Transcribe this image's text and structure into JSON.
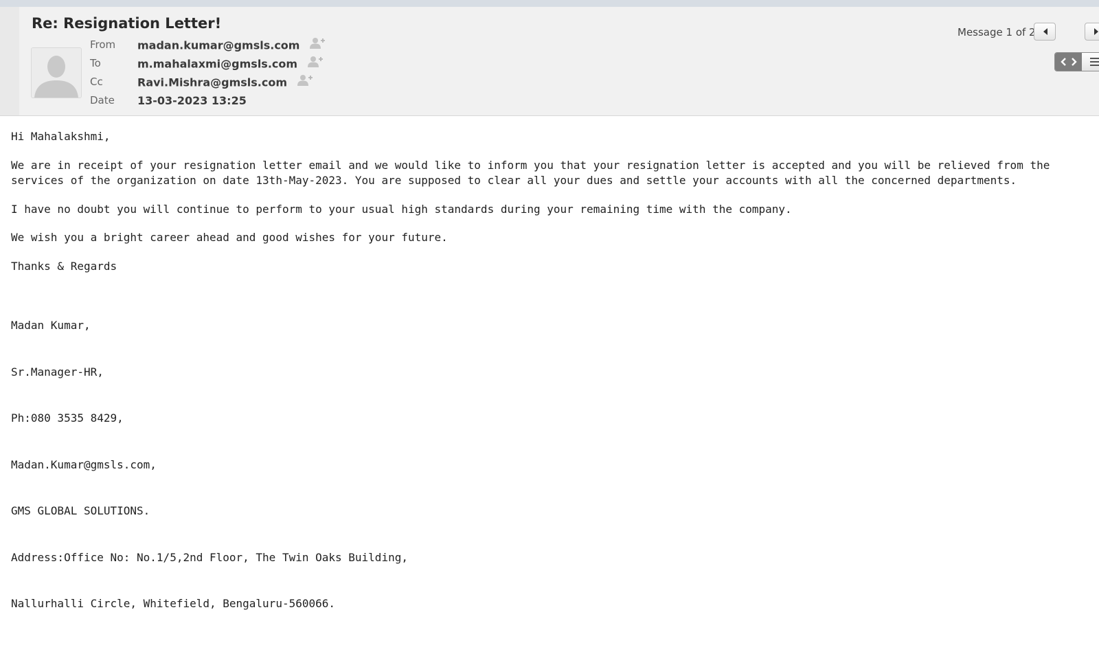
{
  "message": {
    "subject": "Re: Resignation Letter!",
    "counter": "Message 1 of 2",
    "fields": {
      "from_label": "From",
      "from_value": "madan.kumar@gmsls.com",
      "to_label": "To",
      "to_value": "m.mahalaxmi@gmsls.com",
      "cc_label": "Cc",
      "cc_value": "Ravi.Mishra@gmsls.com",
      "date_label": "Date",
      "date_value": "13-03-2023 13:25"
    }
  },
  "body": {
    "greeting": "Hi Mahalakshmi,",
    "para1": "We are in receipt of your resignation letter email and we would like to inform you that your resignation letter is accepted and you will be relieved from the services of the organization on date 13th-May-2023. You are supposed to clear all your dues and settle your accounts with all the concerned departments.",
    "para2": "I have no doubt you will continue to perform to your usual high standards during your remaining time with the company.",
    "para3": "We wish you a bright career ahead and good wishes for your future.",
    "closing": "Thanks & Regards",
    "signature": [
      "Madan Kumar,",
      "Sr.Manager-HR,",
      "Ph:080 3535 8429,",
      "Madan.Kumar@gmsls.com,",
      "GMS GLOBAL SOLUTIONS.",
      "Address:Office No: No.1/5,2nd Floor, The Twin Oaks Building,",
      "Nallurhalli Circle, Whitefield, Bengaluru-560066."
    ]
  },
  "icons": {
    "avatar": "user-silhouette-icon",
    "add_contact": "add-contact-icon",
    "prev": "triangle-left-icon",
    "next": "triangle-right-icon",
    "source_view": "code-brackets-icon",
    "text_view": "lines-icon"
  },
  "colors": {
    "header_bg": "#f1f1f1",
    "active_toggle": "#7d7d7d"
  }
}
